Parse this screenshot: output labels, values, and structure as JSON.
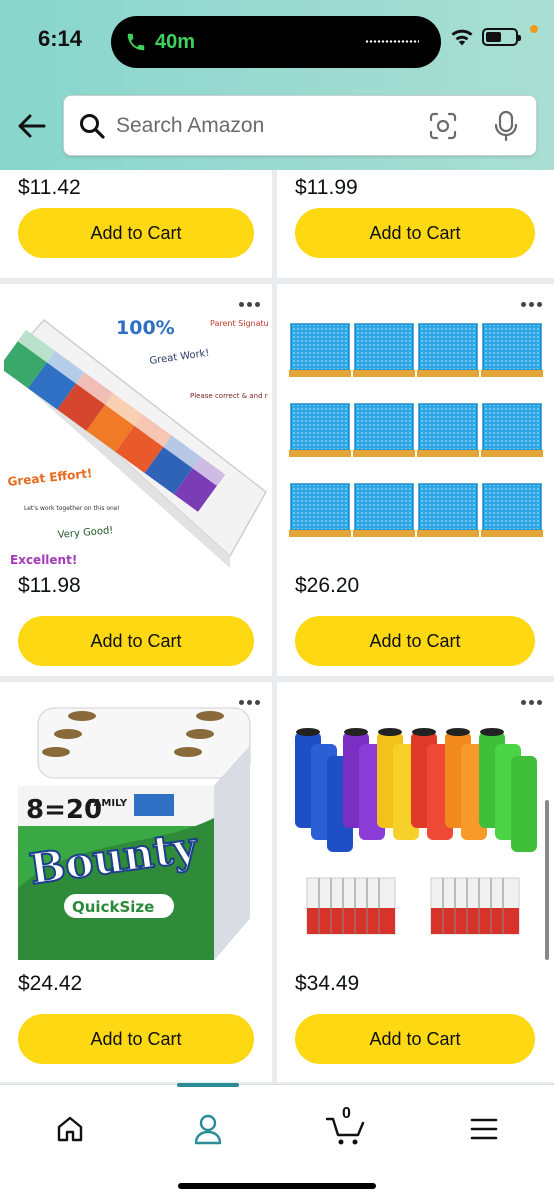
{
  "status_bar": {
    "time": "6:14",
    "call_duration": "40m"
  },
  "search": {
    "placeholder": "Search Amazon"
  },
  "products": [
    {
      "price": "$11.42",
      "cart_label": "Add to Cart"
    },
    {
      "price": "$11.99",
      "cart_label": "Add to Cart"
    },
    {
      "price": "$11.98",
      "cart_label": "Add to Cart"
    },
    {
      "price": "$26.20",
      "cart_label": "Add to Cart"
    },
    {
      "price": "$24.42",
      "cart_label": "Add to Cart"
    },
    {
      "price": "$34.49",
      "cart_label": "Add to Cart"
    }
  ],
  "product_images": {
    "sticky_notes": {
      "headline": "100%",
      "notes": [
        "Parent Signature",
        "Great Work!",
        "Please correct & and return",
        "Great Effort!",
        "Let's work together on this one!",
        "Very Good!",
        "Excellent!"
      ]
    },
    "bounty": {
      "count_badge": "8=20",
      "count_label": "FAMILY",
      "brand": "Bounty",
      "variant": "QuickSize"
    }
  },
  "bottom_nav": {
    "cart_count": "0",
    "active": "profile"
  },
  "colors": {
    "header_accent": "#87d6cc",
    "button": "#ffd814",
    "active_tab": "#2a8a96"
  },
  "icons": [
    "back-arrow-icon",
    "search-icon",
    "camera-scan-icon",
    "microphone-icon",
    "home-icon",
    "profile-icon",
    "cart-icon",
    "menu-icon"
  ]
}
